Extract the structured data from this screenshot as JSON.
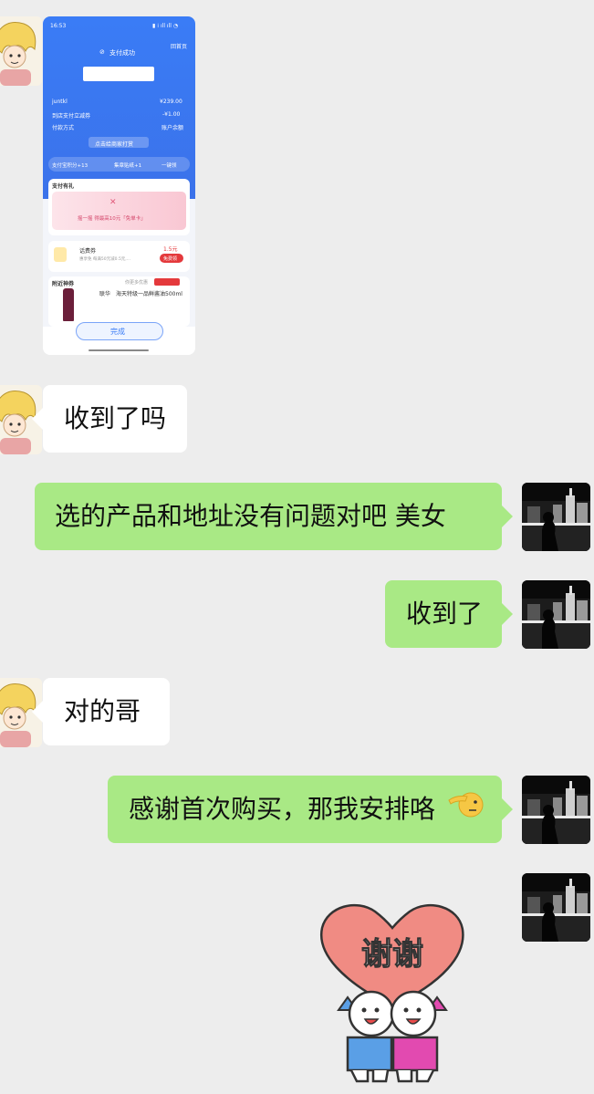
{
  "screenshot": {
    "status_time": "16:53",
    "back_home": "回首页",
    "pay_success": "支付成功",
    "merchant_name": "juntkl",
    "amount": "¥239.00",
    "discount_label": "到店支付立减券",
    "discount_value": "-¥1.00",
    "pay_method_label": "付款方式",
    "pay_method_value": "账户余额",
    "rate_button": "点击给商家打赏",
    "points": "支付宝积分+13",
    "reward": "集章贴纸+1",
    "one_click": "一键领",
    "gift_title": "支付有礼",
    "gift_text": "摇一摇 得最高10元「免单卡」",
    "coupon_title": "话费券",
    "coupon_sub": "惠享免   每满50元减0.5元,...",
    "coupon_value": "1.5元",
    "coupon_button": "免费领",
    "nearby_title": "附近神券",
    "nearby_more": "你更多优惠",
    "product_tag": "联华",
    "product_name": "海天特级一品鲜酱油500ml",
    "done_button": "完成"
  },
  "messages": [
    {
      "side": "left",
      "text": "收到了吗"
    },
    {
      "side": "right",
      "text": "选的产品和地址没有问题对吧 美女"
    },
    {
      "side": "right",
      "text": "收到了"
    },
    {
      "side": "left",
      "text": "对的哥"
    },
    {
      "side": "right",
      "text": "感谢首次购买，那我安排咯"
    }
  ],
  "sticker": {
    "text": "谢谢"
  },
  "colors": {
    "background": "#ededed",
    "bubble_green": "#a9e985",
    "bubble_white": "#ffffff",
    "alipay_blue": "#3a7cf6"
  }
}
